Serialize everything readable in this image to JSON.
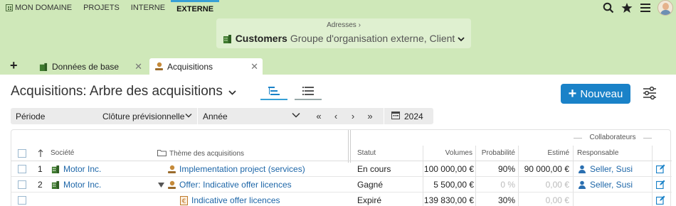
{
  "topnav": {
    "items": [
      {
        "label": "MON DOMAINE"
      },
      {
        "label": "PROJETS"
      },
      {
        "label": "INTERNE"
      },
      {
        "label": "EXTERNE"
      }
    ]
  },
  "context": {
    "breadcrumb": "Adresses",
    "title": "Customers",
    "subtitle": "Groupe d'organisation externe, Client"
  },
  "tabs": [
    {
      "label": "Données de base"
    },
    {
      "label": "Acquisitions"
    }
  ],
  "page": {
    "title": "Acquisitions: Arbre des acquisitions",
    "new_button": "Nouveau"
  },
  "filter": {
    "periode": "Période",
    "cloture": "Clôture prévisionnelle",
    "annee": "Année",
    "year": "2024"
  },
  "table": {
    "collab_header": "Collaborateurs",
    "headers": {
      "societe": "Société",
      "theme": "Thème des acquisitions",
      "statut": "Statut",
      "volumes": "Volumes",
      "probabilite": "Probabilité",
      "estime": "Estimé",
      "responsable": "Responsable"
    },
    "rows": [
      {
        "num": "1",
        "societe": "Motor Inc.",
        "theme": "Implementation project (services)",
        "statut": "En cours",
        "volumes": "100 000,00 €",
        "probabilite": "90%",
        "estime": "90 000,00 €",
        "responsable": "Seller, Susi"
      },
      {
        "num": "2",
        "societe": "Motor Inc.",
        "theme": "Offer: Indicative offer licences",
        "statut": "Gagné",
        "volumes": "5 500,00 €",
        "probabilite": "0 %",
        "estime": "0,00 €",
        "responsable": "Seller, Susi"
      },
      {
        "num": "",
        "societe": "",
        "theme": "Indicative offer licences",
        "statut": "Expiré",
        "volumes": "139 830,00 €",
        "probabilite": "30%",
        "estime": "0,00 €",
        "responsable": ""
      }
    ]
  },
  "colors": {
    "header_green": "#cfe8b9",
    "accent_blue": "#1a82c8",
    "link": "#1d66a8"
  }
}
